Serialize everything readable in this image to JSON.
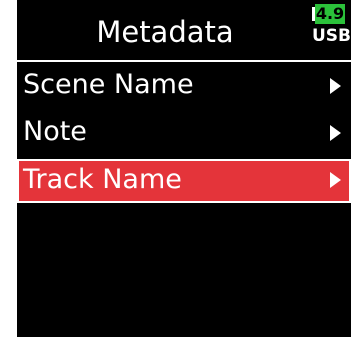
{
  "header": {
    "title": "Metadata"
  },
  "status": {
    "battery_level": "4.9",
    "power_source": "USB",
    "battery_color": "#2bc13a",
    "icon": "battery-icon"
  },
  "menu": {
    "items": [
      {
        "label": "Scene Name",
        "selected": false,
        "icon": "chevron-right-icon"
      },
      {
        "label": "Note",
        "selected": false,
        "icon": "chevron-right-icon"
      },
      {
        "label": "Track Name",
        "selected": true,
        "icon": "chevron-right-icon"
      }
    ],
    "selected_color": "#e4343a"
  }
}
